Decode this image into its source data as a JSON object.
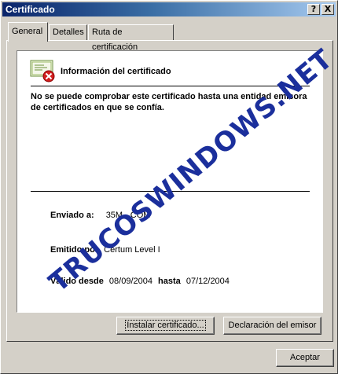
{
  "window": {
    "title": "Certificado"
  },
  "titlebar_buttons": {
    "help": "?",
    "close": "X"
  },
  "tabs": [
    {
      "label": "General",
      "active": true
    },
    {
      "label": "Detalles",
      "active": false
    },
    {
      "label": "Ruta de certificación",
      "active": false
    }
  ],
  "cert": {
    "icon": "certificate-error-icon",
    "title": "Información del certificado",
    "message": "No se puede comprobar este certificado hasta una entidad emisora de certificados en que se confía.",
    "issued_to_label": "Enviado a:",
    "issued_to_value": "35M   .COM",
    "issued_by_label": "Emitido por",
    "issued_by_value": "Certum Level I",
    "valid_from_label": "Válido desde",
    "valid_from_value": "08/09/2004",
    "valid_to_label": "hasta",
    "valid_to_value": "07/12/2004"
  },
  "buttons": {
    "install": "Instalar certificado...",
    "issuer_statement": "Declaración del emisor",
    "ok": "Aceptar"
  },
  "watermark": "TRUCOSWINDOWS.NET",
  "colors": {
    "titlebar_start": "#0a246a",
    "titlebar_end": "#a6caf0",
    "watermark": "#1b2f9c",
    "error": "#d11e1e"
  }
}
